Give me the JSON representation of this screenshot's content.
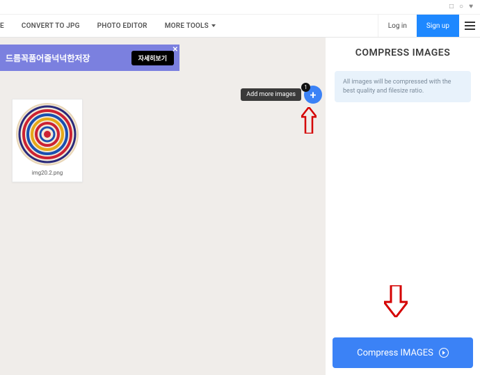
{
  "nav": {
    "item0": "E",
    "item1": "CONVERT TO JPG",
    "item2": "PHOTO EDITOR",
    "item3": "MORE TOOLS"
  },
  "auth": {
    "login": "Log in",
    "signup": "Sign up"
  },
  "ad": {
    "text": "드름꼭품어줄넉넉한저장",
    "button": "자세히보기"
  },
  "image": {
    "filename": "img20.2.png"
  },
  "addmore": {
    "tooltip": "Add more images",
    "badge": "1"
  },
  "sidebar": {
    "title": "COMPRESS IMAGES",
    "info": "All images will be compressed with the best quality and filesize ratio.",
    "button": "Compress IMAGES"
  }
}
